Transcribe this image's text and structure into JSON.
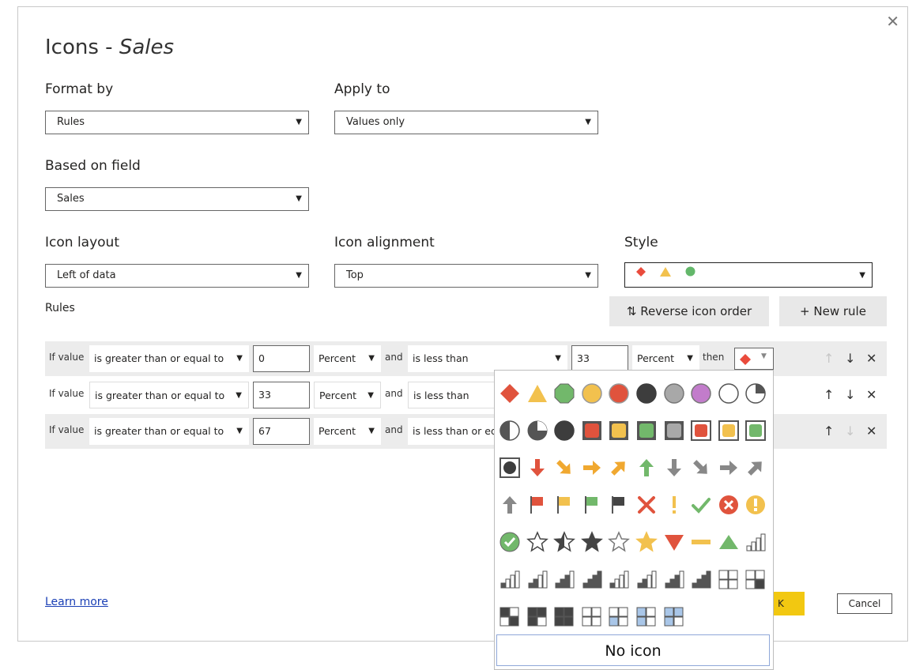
{
  "dialog": {
    "title_main": "Icons - ",
    "title_field": "Sales",
    "close": "✕"
  },
  "format_by": {
    "label": "Format by",
    "value": "Rules"
  },
  "apply_to": {
    "label": "Apply to",
    "value": "Values only"
  },
  "based_on": {
    "label": "Based on field",
    "value": "Sales"
  },
  "icon_layout": {
    "label": "Icon layout",
    "value": "Left of data"
  },
  "icon_alignment": {
    "label": "Icon alignment",
    "value": "Top"
  },
  "style": {
    "label": "Style",
    "icons": [
      "red-diamond-icon",
      "yellow-triangle-icon",
      "green-circle-icon"
    ]
  },
  "buttons": {
    "reverse": "⇅ Reverse icon order",
    "new_rule": "+ New rule"
  },
  "rules": {
    "label": "Rules",
    "if_value": "If value",
    "and": "and",
    "then": "then",
    "items": [
      {
        "op1": "is greater than or equal to",
        "val1": "0",
        "type1": "Percent",
        "op2": "is less than",
        "val2": "33",
        "type2": "Percent",
        "icon": "red-diamond-icon",
        "up_enabled": false,
        "down_enabled": true
      },
      {
        "op1": "is greater than or equal to",
        "val1": "33",
        "type1": "Percent",
        "op2": "is less than",
        "up_enabled": true,
        "down_enabled": true
      },
      {
        "op1": "is greater than or equal to",
        "val1": "67",
        "type1": "Percent",
        "op2": "is less than or eq",
        "up_enabled": true,
        "down_enabled": false
      }
    ]
  },
  "footer": {
    "learn_more": "Learn more",
    "ok": "K",
    "cancel": "Cancel"
  },
  "picker": {
    "no_icon": "No icon"
  },
  "colors": {
    "red": "#d9644a",
    "yellow": "#efc865",
    "green": "#7fba70",
    "dark": "#4a4a4a",
    "grey": "#9e9e9e",
    "purple": "#c47cc9",
    "blue": "#a9c6e8",
    "accent": "#f2c811"
  }
}
